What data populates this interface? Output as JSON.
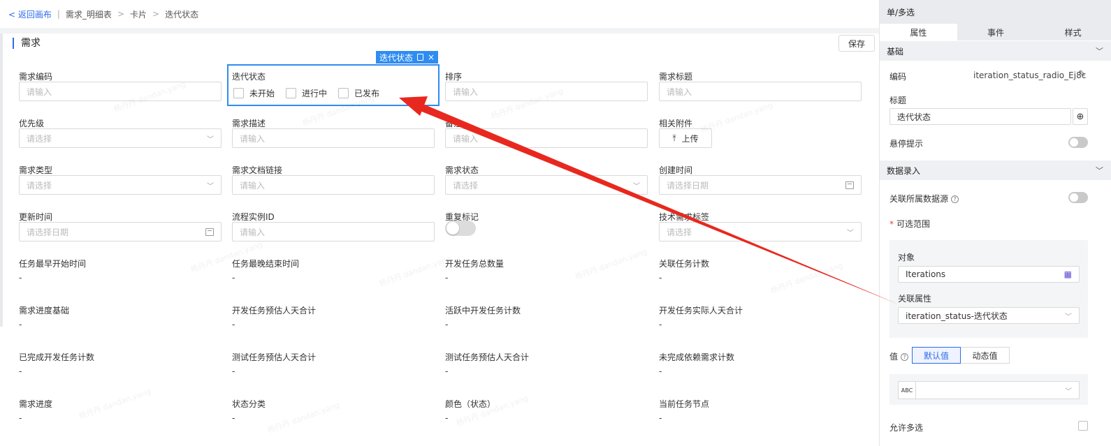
{
  "breadcrumb": {
    "back": "< 返回画布",
    "sep1": "|",
    "item1": "需求_明细表",
    "sep2": ">",
    "item2": "卡片",
    "sep3": ">",
    "item3": "迭代状态"
  },
  "card": {
    "title": "需求",
    "save_label": "保存"
  },
  "selection_tag": {
    "label": "迭代状态",
    "close": "×"
  },
  "fields": {
    "req_code": {
      "label": "需求编码",
      "placeholder": "请输入"
    },
    "iter_status": {
      "label": "迭代状态",
      "options": [
        "未开始",
        "进行中",
        "已发布"
      ]
    },
    "sort": {
      "label": "排序",
      "placeholder": "请输入"
    },
    "req_title": {
      "label": "需求标题",
      "placeholder": "请输入"
    },
    "priority": {
      "label": "优先级",
      "placeholder": "请选择"
    },
    "req_desc": {
      "label": "需求描述",
      "placeholder": "请输入"
    },
    "remark": {
      "label": "备注",
      "placeholder": "请输入"
    },
    "attachment": {
      "label": "相关附件",
      "button": "上传"
    },
    "req_type": {
      "label": "需求类型",
      "placeholder": "请选择"
    },
    "doc_link": {
      "label": "需求文档链接",
      "placeholder": "请输入"
    },
    "req_status": {
      "label": "需求状态",
      "placeholder": "请选择"
    },
    "create_time": {
      "label": "创建时间",
      "placeholder": "请选择日期"
    },
    "update_time": {
      "label": "更新时间",
      "placeholder": "请选择日期"
    },
    "flow_id": {
      "label": "流程实例ID",
      "placeholder": "请输入"
    },
    "dup_flag": {
      "label": "重复标记"
    },
    "tech_tag": {
      "label": "技术需求标签",
      "placeholder": "请选择"
    }
  },
  "readonly_rows": [
    [
      "任务最早开始时间",
      "任务最晚结束时间",
      "开发任务总数量",
      "关联任务计数"
    ],
    [
      "需求进度基础",
      "开发任务预估人天合计",
      "活跃中开发任务计数",
      "开发任务实际人天合计"
    ],
    [
      "已完成开发任务计数",
      "测试任务预估人天合计",
      "测试任务预估人天合计",
      "未完成依赖需求计数"
    ],
    [
      "需求进度",
      "状态分类",
      "颜色（状态）",
      "当前任务节点"
    ]
  ],
  "readonly_value": "-",
  "watermark": "杨丹丹 dandan.yang",
  "panel": {
    "title": "单/多选",
    "tabs": [
      "属性",
      "事件",
      "样式"
    ],
    "basic": {
      "section": "基础",
      "code_label": "编码",
      "code_value": "iteration_status_radio_Ej8c",
      "title_label": "标题",
      "title_value": "迭代状态",
      "tooltip_label": "悬停提示"
    },
    "data": {
      "section": "数据录入",
      "link_source_label": "关联所属数据源",
      "range_label": "可选范围",
      "object_label": "对象",
      "object_value": "Iterations",
      "attr_label": "关联属性",
      "attr_value": "iteration_status-迭代状态",
      "value_label": "值",
      "default_value": "默认值",
      "dynamic_value": "动态值",
      "abc": "ABC",
      "multi_label": "允许多选"
    }
  },
  "colors": {
    "accent": "#2f6bea",
    "selection": "#2f8cf0",
    "arrow": "#e8281e"
  }
}
